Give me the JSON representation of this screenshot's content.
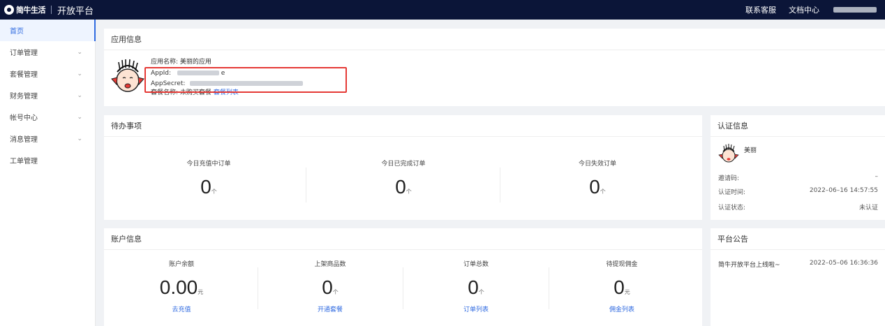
{
  "topbar": {
    "logo_text": "简牛生活",
    "platform": "开放平台",
    "links": [
      "联系客服",
      "文档中心"
    ]
  },
  "sidebar": {
    "items": [
      {
        "label": "首页",
        "active": true,
        "has_chevron": false
      },
      {
        "label": "订单管理",
        "has_chevron": true
      },
      {
        "label": "套餐管理",
        "has_chevron": true
      },
      {
        "label": "财务管理",
        "has_chevron": true
      },
      {
        "label": "帐号中心",
        "has_chevron": true
      },
      {
        "label": "消息管理",
        "has_chevron": true
      },
      {
        "label": "工单管理",
        "has_chevron": false
      }
    ]
  },
  "app_info": {
    "title": "应用信息",
    "name_label": "应用名称:",
    "name_value": "美丽的应用",
    "appid_label": "AppId:",
    "appid_visible_suffix": "e",
    "secret_label": "AppSecret:",
    "package_label": "套餐名称:",
    "package_value": "未购买套餐",
    "package_link": "套餐列表"
  },
  "pending": {
    "title": "待办事项",
    "stats": [
      {
        "label": "今日充值中订单",
        "value": "0",
        "unit": "个"
      },
      {
        "label": "今日已完成订单",
        "value": "0",
        "unit": "个"
      },
      {
        "label": "今日失效订单",
        "value": "0",
        "unit": "个"
      }
    ]
  },
  "cert": {
    "title": "认证信息",
    "name": "美丽",
    "rows": [
      {
        "label": "邀请码:",
        "value": "–"
      },
      {
        "label": "认证时间:",
        "value": "2022–06–16 14:57:55"
      },
      {
        "label": "认证状态:",
        "value": "未认证"
      }
    ]
  },
  "account": {
    "title": "账户信息",
    "stats": [
      {
        "label": "账户余额",
        "value": "0.00",
        "unit": "元",
        "link": "去充值"
      },
      {
        "label": "上架商品数",
        "value": "0",
        "unit": "个",
        "link": "开通套餐"
      },
      {
        "label": "订单总数",
        "value": "0",
        "unit": "个",
        "link": "订单列表"
      },
      {
        "label": "待提现佣金",
        "value": "0",
        "unit": "元",
        "link": "佣金列表"
      }
    ]
  },
  "notice": {
    "title": "平台公告",
    "items": [
      {
        "text": "简牛开放平台上线啦~",
        "date": "2022–05–06 16:36:36"
      }
    ]
  },
  "colors": {
    "topbar_bg": "#0b1538",
    "accent": "#2f6ae0",
    "highlight_box": "#e53935"
  }
}
